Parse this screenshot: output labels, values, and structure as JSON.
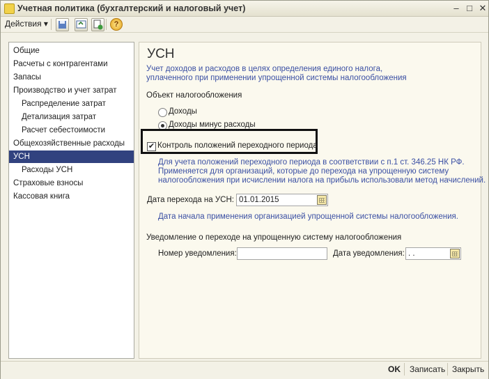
{
  "window": {
    "title": "Учетная политика (бухгалтерский и налоговый учет)",
    "minimize_glyph": "–",
    "maximize_glyph": "□",
    "close_glyph": "✕"
  },
  "toolbar": {
    "actions_label": "Действия",
    "actions_arrow": "▾",
    "icons": [
      "save-icon",
      "refresh-icon",
      "copy-icon",
      "help-icon"
    ],
    "help_glyph": "?"
  },
  "sidebar": {
    "items": [
      {
        "label": "Общие"
      },
      {
        "label": "Расчеты с контрагентами"
      },
      {
        "label": "Запасы"
      },
      {
        "label": "Производство и учет затрат"
      },
      {
        "label": "Распределение затрат"
      },
      {
        "label": "Детализация затрат"
      },
      {
        "label": "Расчет себестоимости"
      },
      {
        "label": "Общехозяйственные расходы"
      },
      {
        "label": "УСН"
      },
      {
        "label": "Расходы УСН"
      },
      {
        "label": "Страховые взносы"
      },
      {
        "label": "Кассовая книга"
      }
    ],
    "selected_index": 8
  },
  "main": {
    "title": "УСН",
    "subtitle_line1": "Учет доходов и расходов в целях определения единого налога,",
    "subtitle_line2": "уплаченного при применении упрощенной системы налогообложения",
    "tax_object_label": "Объект налогообложения",
    "radio_income": "Доходы",
    "radio_income_minus": "Доходы минус расходы",
    "radio_selected": "Доходы минус расходы",
    "transition_checkbox_label": "Контроль положений переходного периода",
    "transition_checkbox_checked": true,
    "checkmark": "✔",
    "transition_note_line1": "Для учета положений переходного периода в соответствии с п.1 ст. 346.25 НК РФ.",
    "transition_note_line2": "Применяется для организаций, которые до перехода на упрощенную систему",
    "transition_note_line3": "налогообложения при исчислении налога на прибыль использовали метод начислений.",
    "transition_date_label": "Дата перехода на УСН:",
    "transition_date_value": "01.01.2015",
    "transition_date_note": "Дата начала применения организацией упрощенной системы налогообложения.",
    "notice_section_label": "Уведомление о переходе на упрощенную систему налогообложения",
    "notice_number_label": "Номер уведомления:",
    "notice_number_value": "",
    "notice_date_label": "Дата уведомления:",
    "notice_date_value": " .  ."
  },
  "bottom": {
    "ok_label": "OK",
    "save_label": "Записать",
    "close_label": "Закрыть"
  },
  "colors": {
    "selection": "#31427f",
    "accent_text": "#3a4fa3"
  }
}
